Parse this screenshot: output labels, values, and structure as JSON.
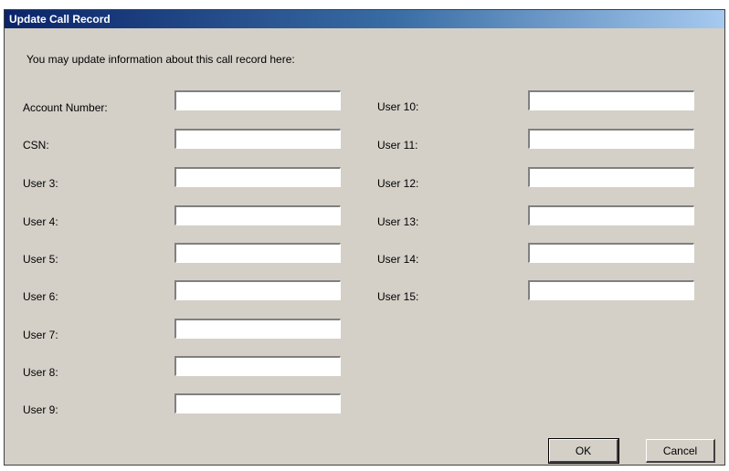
{
  "window": {
    "title": "Update Call Record"
  },
  "intro": "You may update information about this call record here:",
  "left_fields": [
    {
      "label": "Account Number:",
      "value": ""
    },
    {
      "label": "CSN:",
      "value": ""
    },
    {
      "label": "User 3:",
      "value": ""
    },
    {
      "label": "User 4:",
      "value": ""
    },
    {
      "label": "User 5:",
      "value": ""
    },
    {
      "label": "User 6:",
      "value": ""
    },
    {
      "label": "User 7:",
      "value": ""
    },
    {
      "label": "User 8:",
      "value": ""
    },
    {
      "label": "User 9:",
      "value": ""
    }
  ],
  "right_fields": [
    {
      "label": "User 10:",
      "value": ""
    },
    {
      "label": "User 11:",
      "value": ""
    },
    {
      "label": "User 12:",
      "value": ""
    },
    {
      "label": "User 13:",
      "value": ""
    },
    {
      "label": "User 14:",
      "value": ""
    },
    {
      "label": "User 15:",
      "value": ""
    }
  ],
  "buttons": {
    "ok": "OK",
    "cancel": "Cancel"
  }
}
